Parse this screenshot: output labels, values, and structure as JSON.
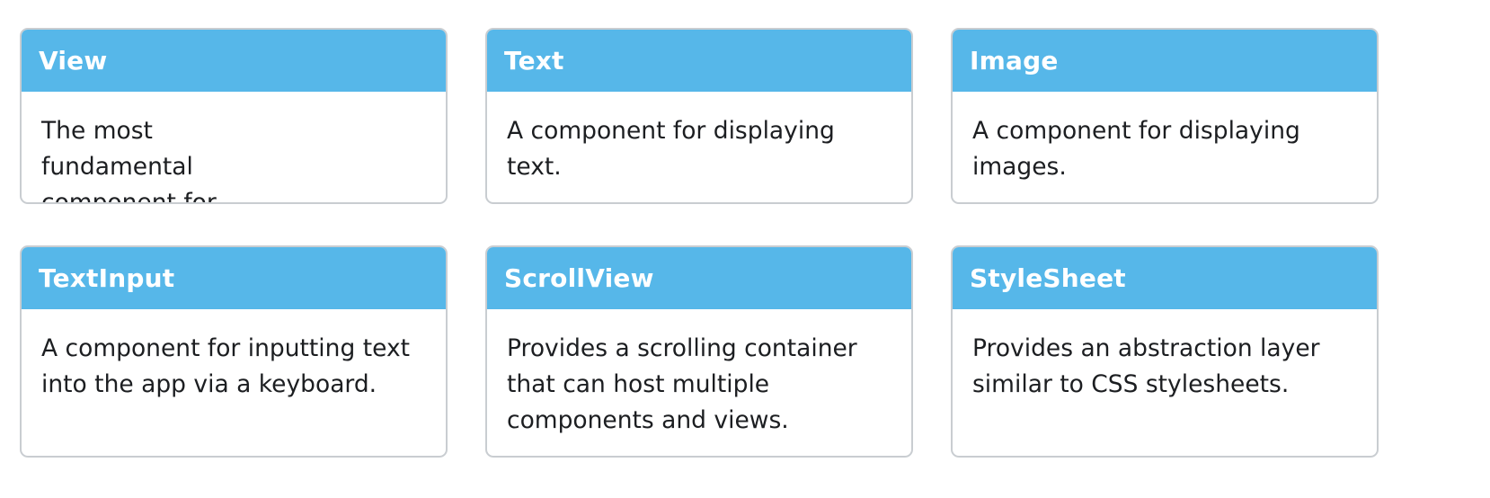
{
  "cards": [
    {
      "title": "View",
      "description": "The most fundamental component for building a UI."
    },
    {
      "title": "Text",
      "description": "A component for displaying text."
    },
    {
      "title": "Image",
      "description": "A component for displaying images."
    },
    {
      "title": "TextInput",
      "description": "A component for inputting text into the app via a keyboard."
    },
    {
      "title": "ScrollView",
      "description": "Provides a scrolling container that can host multiple components and views."
    },
    {
      "title": "StyleSheet",
      "description": "Provides an abstraction layer similar to CSS stylesheets."
    }
  ],
  "colors": {
    "header_bg": "#56b7e9",
    "header_text": "#ffffff",
    "body_text": "#1c1e21",
    "border": "#c9cdd1"
  }
}
